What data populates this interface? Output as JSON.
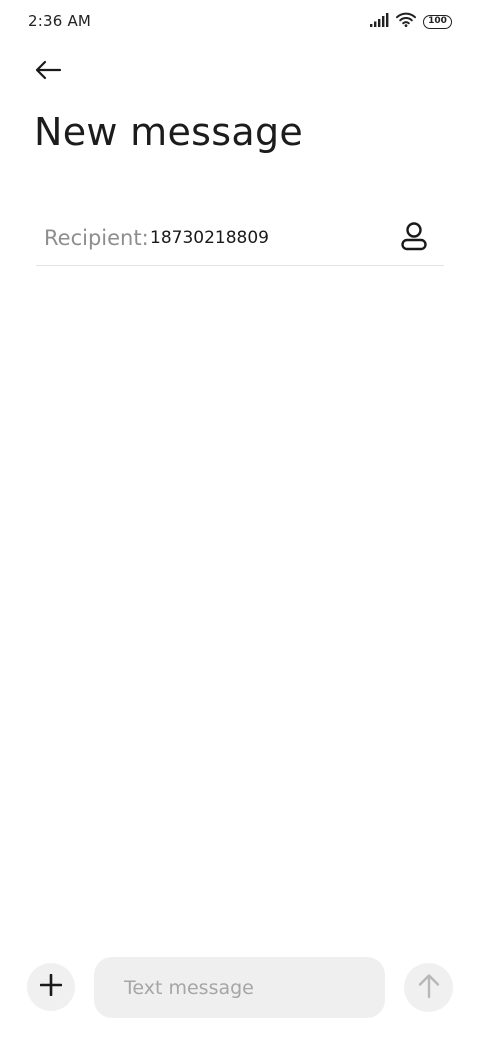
{
  "status_bar": {
    "time": "2:36 AM",
    "battery_level": "100",
    "icons": [
      "signal-icon",
      "wifi-icon",
      "battery-icon"
    ]
  },
  "header": {
    "back_icon": "back-arrow-icon",
    "title": "New message"
  },
  "recipient": {
    "label": "Recipient:",
    "value": "18730218809",
    "contact_icon": "contact-person-icon"
  },
  "composer": {
    "add_icon": "plus-icon",
    "placeholder": "Text message",
    "send_icon": "arrow-up-icon"
  },
  "colors": {
    "background": "#ffffff",
    "input_background": "#efefef",
    "placeholder": "#a6a6a6",
    "label": "#8e8e8e",
    "divider": "#e2e2e2"
  }
}
